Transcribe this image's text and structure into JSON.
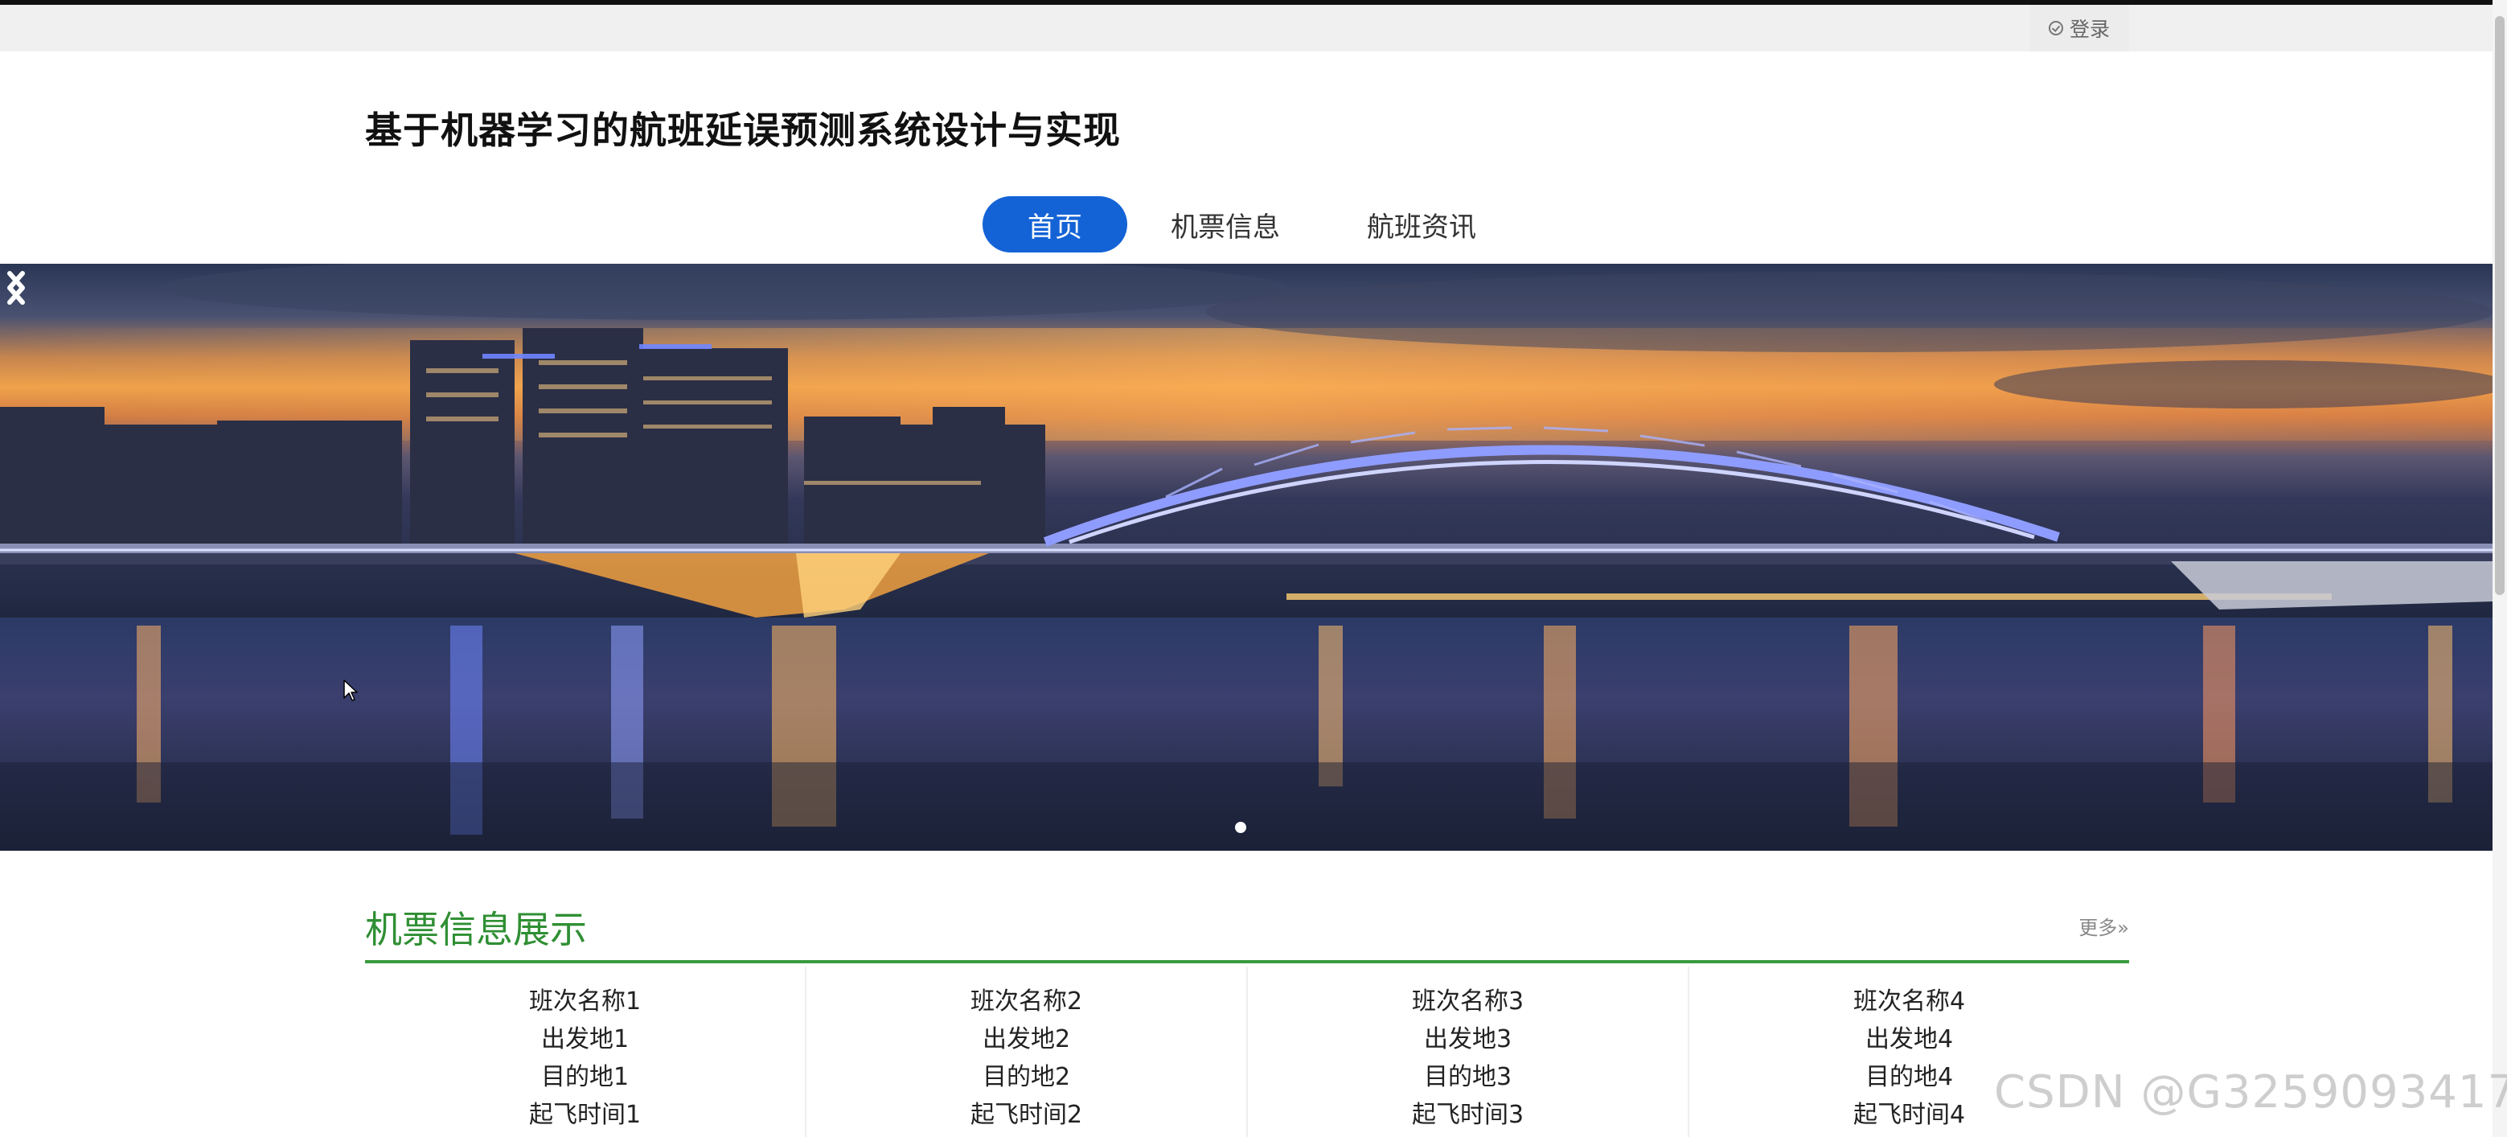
{
  "header": {
    "login_label": "登录",
    "site_title": "基于机器学习的航班延误预测系统设计与实现"
  },
  "nav": {
    "items": [
      {
        "label": "首页",
        "active": true
      },
      {
        "label": "机票信息",
        "active": false
      },
      {
        "label": "航班资讯",
        "active": false
      }
    ]
  },
  "banner": {
    "slide_count": 1,
    "active_slide": 0
  },
  "tickets_section": {
    "title": "机票信息展示",
    "more_label": "更多»",
    "cards": [
      {
        "name": "班次名称1",
        "origin": "出发地1",
        "destination": "目的地1",
        "departure": "起飞时间1"
      },
      {
        "name": "班次名称2",
        "origin": "出发地2",
        "destination": "目的地2",
        "departure": "起飞时间2"
      },
      {
        "name": "班次名称3",
        "origin": "出发地3",
        "destination": "目的地3",
        "departure": "起飞时间3"
      },
      {
        "name": "班次名称4",
        "origin": "出发地4",
        "destination": "目的地4",
        "departure": "起飞时间4"
      }
    ]
  },
  "watermark": "CSDN @G3259093417",
  "colors": {
    "nav_active": "#1463d6",
    "section_accent": "#2f8f33"
  }
}
